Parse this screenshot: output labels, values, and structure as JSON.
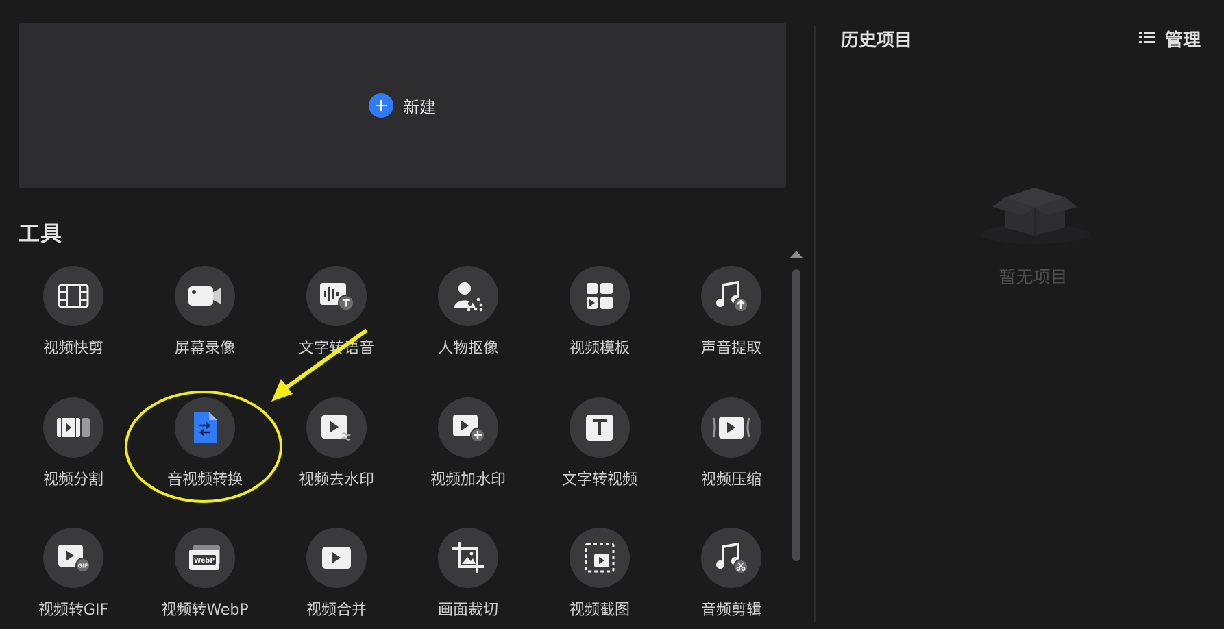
{
  "new_card": {
    "label": "新建",
    "icon": "plus-circle-icon",
    "accent": "#2f7cf6"
  },
  "tools_section": {
    "title": "工具",
    "items": [
      {
        "label": "视频快剪",
        "icon": "film-icon"
      },
      {
        "label": "屏幕录像",
        "icon": "camera-record-icon"
      },
      {
        "label": "文字转语音",
        "icon": "text-to-speech-icon"
      },
      {
        "label": "人物抠像",
        "icon": "person-cutout-icon"
      },
      {
        "label": "视频模板",
        "icon": "template-grid-icon"
      },
      {
        "label": "声音提取",
        "icon": "music-extract-icon"
      },
      {
        "label": "视频分割",
        "icon": "video-split-icon"
      },
      {
        "label": "音视频转换",
        "icon": "file-convert-icon"
      },
      {
        "label": "视频去水印",
        "icon": "remove-watermark-icon"
      },
      {
        "label": "视频加水印",
        "icon": "add-watermark-icon"
      },
      {
        "label": "文字转视频",
        "icon": "text-to-video-icon"
      },
      {
        "label": "视频压缩",
        "icon": "video-compress-icon"
      },
      {
        "label": "视频转GIF",
        "icon": "video-to-gif-icon"
      },
      {
        "label": "视频转WebP",
        "icon": "video-to-webp-icon"
      },
      {
        "label": "视频合并",
        "icon": "video-merge-icon"
      },
      {
        "label": "画面裁切",
        "icon": "crop-icon"
      },
      {
        "label": "视频截图",
        "icon": "screenshot-icon"
      },
      {
        "label": "音频剪辑",
        "icon": "audio-cut-icon"
      }
    ]
  },
  "history": {
    "title": "历史项目",
    "manage_label": "管理",
    "manage_icon": "list-icon",
    "empty_text": "暂无项目",
    "empty_icon": "empty-box-icon"
  },
  "colors": {
    "background": "#1b1b1c",
    "card": "#2d2d2f",
    "tool_circle": "#3a3a3c",
    "highlight": "#f2ee14"
  }
}
